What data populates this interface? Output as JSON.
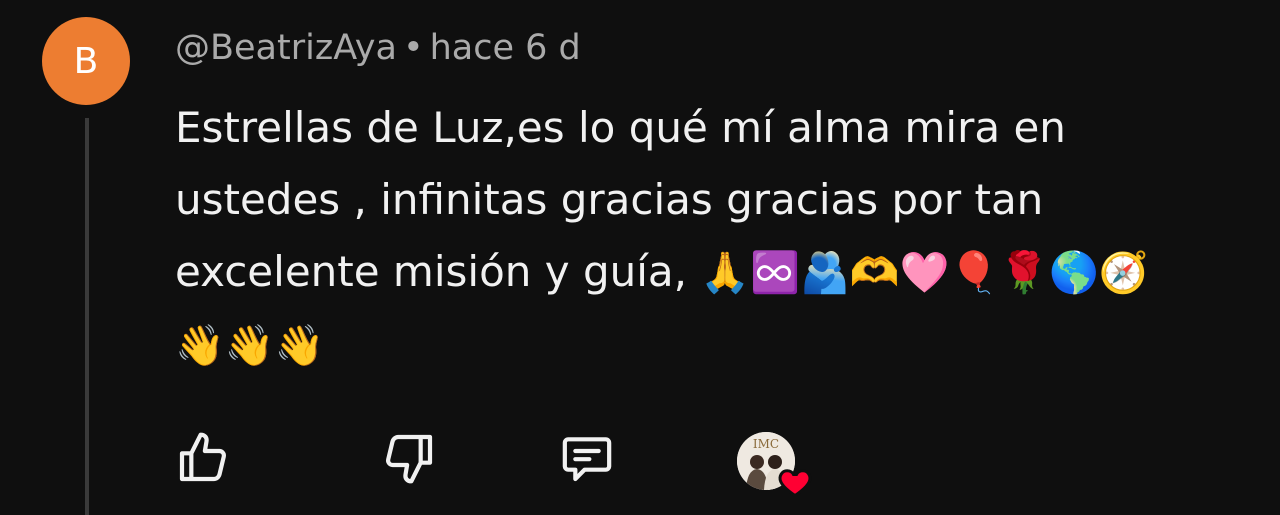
{
  "comment": {
    "avatar_letter": "B",
    "avatar_color": "#ed7d31",
    "author": "@BeatrizAya",
    "separator": "•",
    "timestamp": "hace 6 d",
    "text": "Estrellas de Luz,es lo qué mí alma mira en\nustedes , infinitas gracias gracias por tan\nexcelente misión y guía, ",
    "emojis": "🙏♾️🫂🫶🩷🎈🌹🌎🧭\n👋👋👋"
  },
  "actions": {
    "like_icon": "thumbs-up-icon",
    "dislike_icon": "thumbs-down-icon",
    "reply_icon": "comment-icon",
    "creator_heart_icon": "heart-icon",
    "creator_badge_text": "IMC",
    "heart_color": "#ff0033"
  }
}
